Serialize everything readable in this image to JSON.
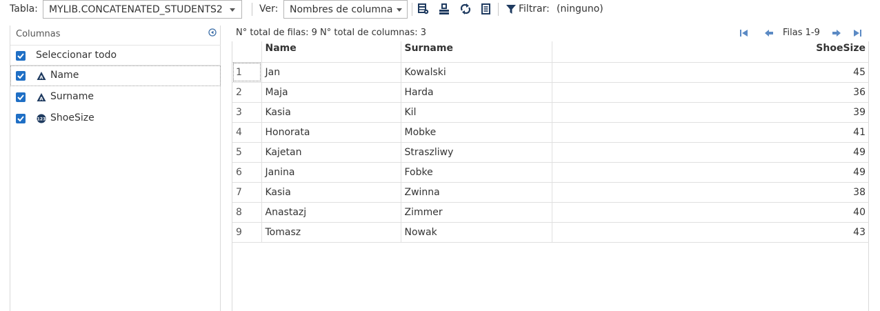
{
  "toolbar": {
    "table_label": "Tabla:",
    "table_value": "MYLIB.CONCATENATED_STUDENTS2",
    "view_label": "Ver:",
    "view_value": "Nombres de columna",
    "filter_label": "Filtrar:",
    "filter_value": "(ninguno)",
    "icons": [
      "table-properties-icon",
      "export-icon",
      "refresh-icon",
      "column-properties-icon",
      "filter-icon"
    ]
  },
  "columns_pane": {
    "title": "Columnas",
    "select_all_label": "Seleccionar todo",
    "items": [
      {
        "label": "Name",
        "type_icon": "character-type-icon",
        "checked": true
      },
      {
        "label": "Surname",
        "type_icon": "character-type-icon",
        "checked": true
      },
      {
        "label": "ShoeSize",
        "type_icon": "numeric-type-icon",
        "checked": true
      }
    ]
  },
  "info": {
    "text": "N° total de filas: 9   N° total de columnas: 3"
  },
  "pager": {
    "label": "Filas 1-9"
  },
  "grid": {
    "headers": [
      "",
      "Name",
      "Surname",
      "ShoeSize"
    ],
    "rows": [
      [
        "1",
        "Jan",
        "Kowalski",
        "45"
      ],
      [
        "2",
        "Maja",
        "Harda",
        "36"
      ],
      [
        "3",
        "Kasia",
        "Kil",
        "39"
      ],
      [
        "4",
        "Honorata",
        "Mobke",
        "41"
      ],
      [
        "5",
        "Kajetan",
        "Straszliwy",
        "49"
      ],
      [
        "6",
        "Janina",
        "Fobke",
        "49"
      ],
      [
        "7",
        "Kasia",
        "Zwinna",
        "38"
      ],
      [
        "8",
        "Anastazj",
        "Zimmer",
        "40"
      ],
      [
        "9",
        "Tomasz",
        "Nowak",
        "43"
      ]
    ]
  },
  "colors": {
    "accent": "#1f6fc5",
    "icon_dark": "#1e3a5f",
    "icon_blue": "#3d6fa8",
    "border": "#e0e0e0"
  }
}
